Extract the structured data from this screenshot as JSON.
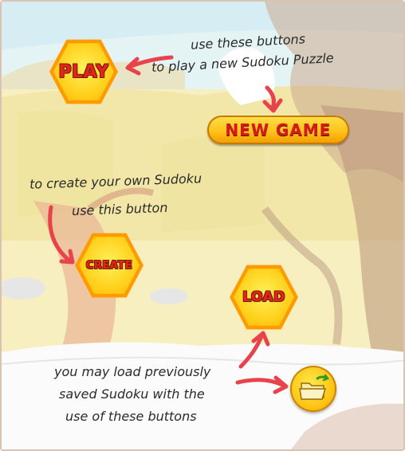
{
  "buttons": {
    "play": "PLAY",
    "new_game": "NEW GAME",
    "create": "CREATE",
    "load": "LOAD"
  },
  "notes": {
    "play_line1": "use these buttons",
    "play_line2": "to play a new Sudoku Puzzle",
    "create_line1": "to create your own Sudoku",
    "create_line2": "use this button",
    "load_line1": "you may load previously",
    "load_line2": "saved Sudoku with the",
    "load_line3": "use of these buttons"
  },
  "icons": {
    "folder": "open-folder-icon",
    "arrows": "red-arrow-icon"
  },
  "colors": {
    "arrow": "#e8434a",
    "button_face": "#ffd21f",
    "button_text": "#e3261a",
    "tree": "#c9a58c"
  }
}
